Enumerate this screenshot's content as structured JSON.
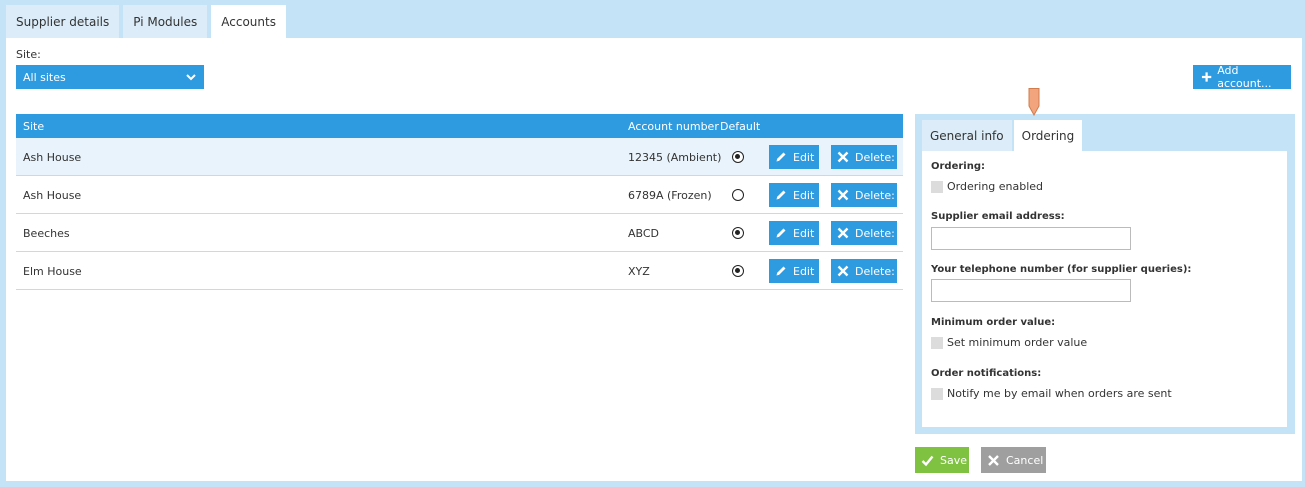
{
  "tabs": [
    "Supplier details",
    "Pi Modules",
    "Accounts"
  ],
  "site_filter": {
    "label": "Site:",
    "value": "All sites"
  },
  "add_account_label": "Add account...",
  "grid": {
    "headers": {
      "site": "Site",
      "account_number": "Account number",
      "default": "Default"
    },
    "rows": [
      {
        "site": "Ash House",
        "account": "12345 (Ambient)",
        "default": true
      },
      {
        "site": "Ash House",
        "account": "6789A (Frozen)",
        "default": false
      },
      {
        "site": "Beeches",
        "account": "ABCD",
        "default": true
      },
      {
        "site": "Elm House",
        "account": "XYZ",
        "default": true
      }
    ],
    "edit_label": "Edit",
    "delete_label": "Delete:"
  },
  "side_tabs": [
    "General info",
    "Ordering"
  ],
  "ordering_form": {
    "ordering_label": "Ordering:",
    "ordering_enabled": "Ordering enabled",
    "email_label": "Supplier email address:",
    "email_value": "",
    "phone_label": "Your telephone number (for supplier queries):",
    "phone_value": "",
    "min_order_label": "Minimum order value:",
    "min_order_check": "Set minimum order value",
    "notifications_label": "Order notifications:",
    "notifications_check": "Notify me by email when orders are sent"
  },
  "actions": {
    "save": "Save",
    "cancel": "Cancel"
  },
  "colors": {
    "accent": "#2e9ae0",
    "save": "#7fc241",
    "cancel": "#9f9f9f",
    "background": "#c5e3f6",
    "indicator": "#f2a57c"
  }
}
